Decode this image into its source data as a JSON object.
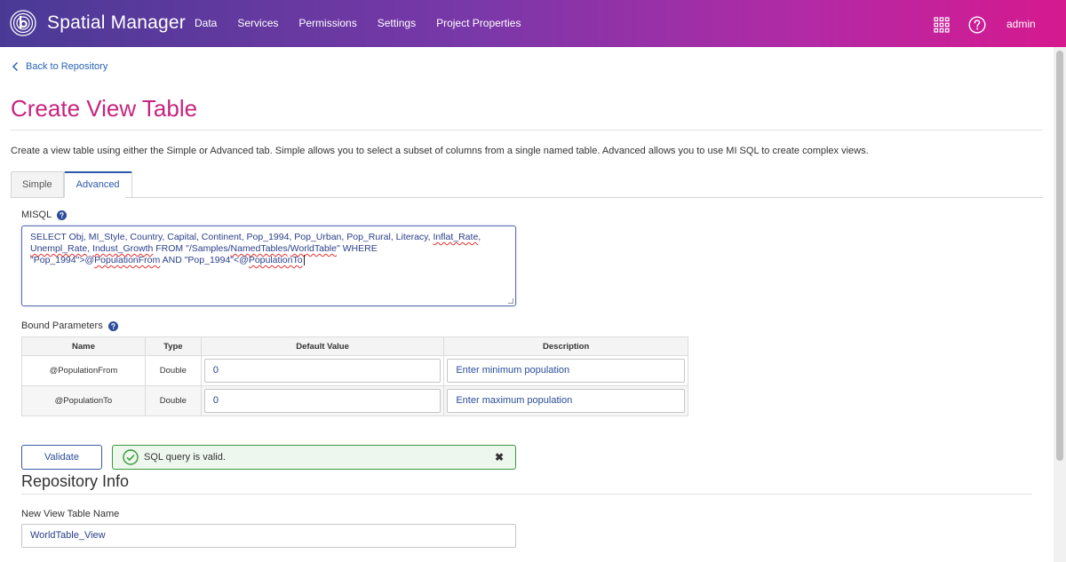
{
  "header": {
    "brand": "Spatial Manager",
    "nav": [
      "Data",
      "Services",
      "Permissions",
      "Settings",
      "Project Properties"
    ],
    "user": "admin"
  },
  "back_link": "Back to Repository",
  "page_title": "Create View Table",
  "intro": "Create a view table using either the Simple or Advanced tab. Simple allows you to select a subset of columns from a single named table. Advanced allows you to use MI SQL to create complex views.",
  "tabs": {
    "simple": "Simple",
    "advanced": "Advanced"
  },
  "misql": {
    "label": "MISQL",
    "line1": {
      "a": "SELECT Obj, MI_Style, Country, Capital, Continent, Pop_1994, Pop_Urban, Pop_Rural, Literacy, ",
      "b": "Inflat_Rate",
      "c": ","
    },
    "line2": {
      "a": "Unempl_Rate",
      "b": ", ",
      "c": "Indust_Growth",
      "d": " FROM \"/Samples/",
      "e": "NamedTables",
      "f": "/",
      "g": "WorldTable",
      "h": "\" WHERE"
    },
    "line3": {
      "a": "\"Pop_1994\">@",
      "b": "PopulationFrom",
      "c": " AND  \"Pop_1994\"<@",
      "d": "PopulationTo"
    }
  },
  "bound_parameters": {
    "label": "Bound Parameters",
    "columns": [
      "Name",
      "Type",
      "Default Value",
      "Description"
    ],
    "rows": [
      {
        "name": "@PopulationFrom",
        "type": "Double",
        "default": "0",
        "description": "Enter minimum population"
      },
      {
        "name": "@PopulationTo",
        "type": "Double",
        "default": "0",
        "description": "Enter maximum population"
      }
    ]
  },
  "validate_label": "Validate",
  "alert": {
    "message": "SQL query is valid.",
    "close": "✖"
  },
  "repository_info": {
    "title": "Repository Info",
    "name_label": "New View Table Name",
    "name_value": "WorldTable_View"
  },
  "colors": {
    "accent": "#c8247f",
    "link": "#2a63b6",
    "success": "#3a9a3a"
  }
}
